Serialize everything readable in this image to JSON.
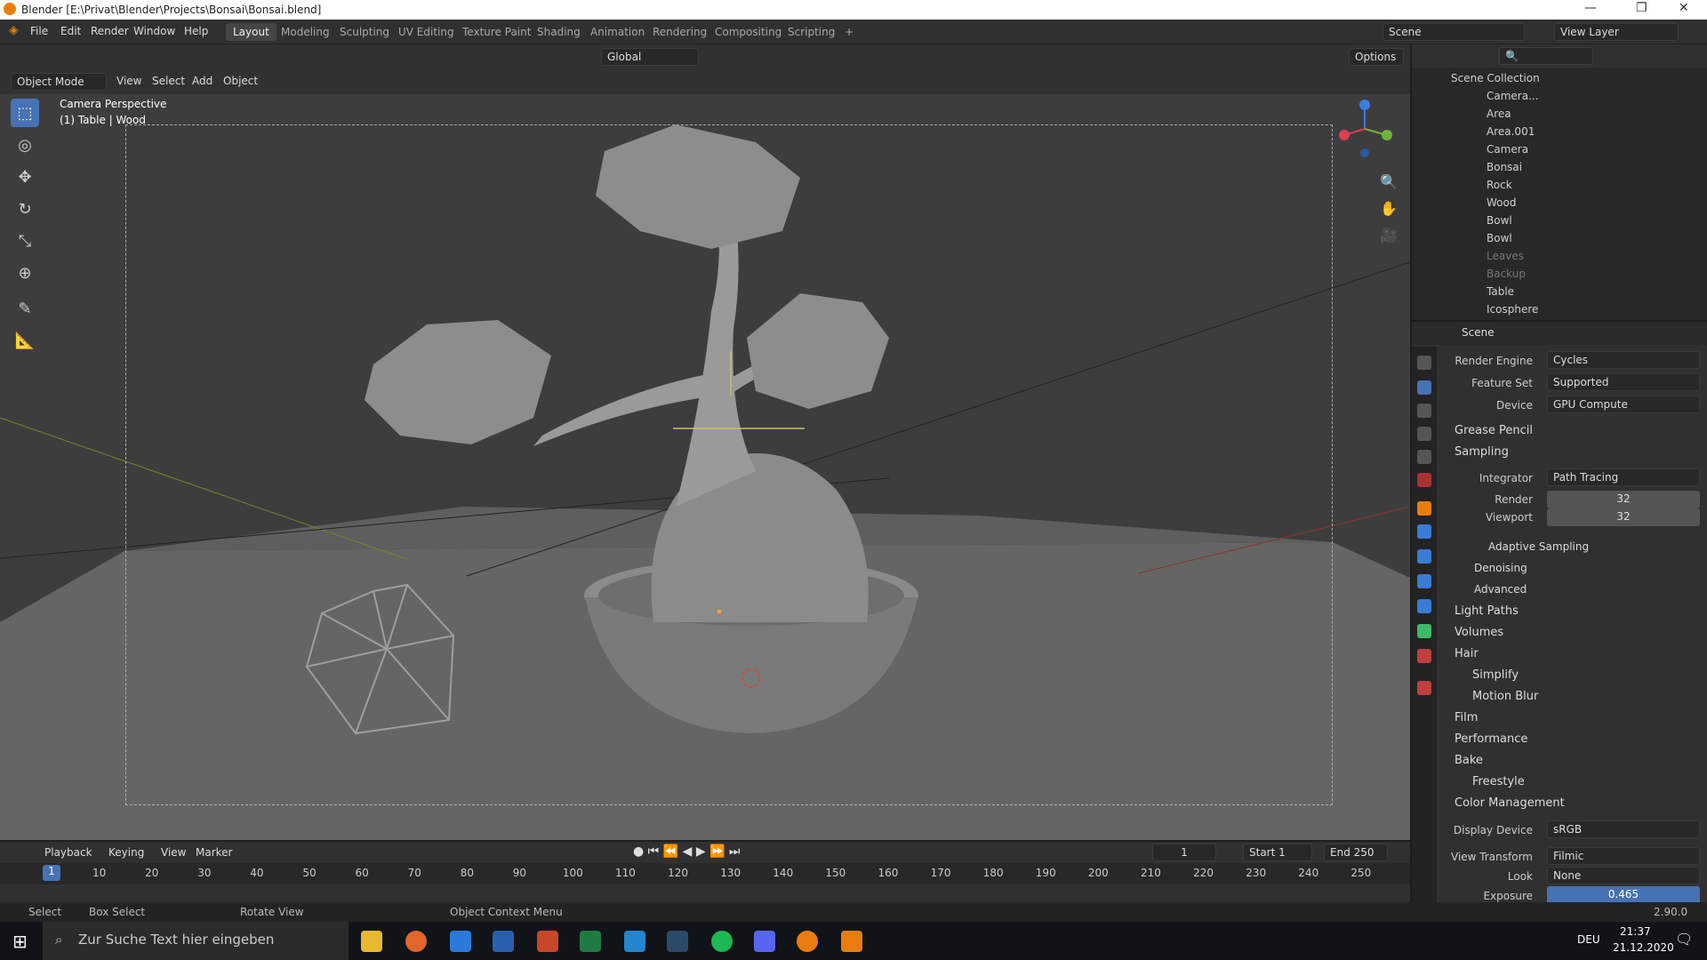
{
  "window": {
    "title": "Blender [E:\\Privat\\Blender\\Projects\\Bonsai\\Bonsai.blend]"
  },
  "menu": [
    "File",
    "Edit",
    "Render",
    "Window",
    "Help"
  ],
  "workspaces": [
    "Layout",
    "Modeling",
    "Sculpting",
    "UV Editing",
    "Texture Paint",
    "Shading",
    "Animation",
    "Rendering",
    "Compositing",
    "Scripting"
  ],
  "scene_name": "Scene",
  "view_layer": "View Layer",
  "viewport": {
    "mode": "Object Mode",
    "menus": [
      "View",
      "Select",
      "Add",
      "Object"
    ],
    "orientation": "Global",
    "options": "Options",
    "camera_label": "Camera Perspective",
    "object_label": "(1) Table | Wood"
  },
  "outliner": {
    "root": "Scene Collection",
    "rows": [
      "Camera...",
      "Area",
      "Area.001",
      "Camera",
      "Bonsai",
      "Rock",
      "Wood",
      "Bowl",
      "Bowl",
      "Leaves",
      "Backup",
      "Table",
      "Icosphere"
    ]
  },
  "properties": {
    "header": "Scene",
    "render_engine_label": "Render Engine",
    "render_engine": "Cycles",
    "feature_set_label": "Feature Set",
    "feature_set": "Supported",
    "device_label": "Device",
    "device": "GPU Compute",
    "grease_pencil": "Grease Pencil",
    "sampling": "Sampling",
    "integrator_label": "Integrator",
    "integrator": "Path Tracing",
    "render_label": "Render",
    "render_samples": "32",
    "viewport_label": "Viewport",
    "viewport_samples": "32",
    "adaptive": "Adaptive Sampling",
    "denoising": "Denoising",
    "advanced": "Advanced",
    "light_paths": "Light Paths",
    "volumes": "Volumes",
    "hair": "Hair",
    "simplify": "Simplify",
    "motion_blur": "Motion Blur",
    "film": "Film",
    "performance": "Performance",
    "bake": "Bake",
    "freestyle": "Freestyle",
    "color_management": "Color Management",
    "display_device_label": "Display Device",
    "display_device": "sRGB",
    "view_transform_label": "View Transform",
    "view_transform": "Filmic",
    "look_label": "Look",
    "look": "None",
    "exposure_label": "Exposure",
    "exposure": "0.465"
  },
  "timeline": {
    "menus": [
      "Playback",
      "Keying",
      "View",
      "Marker"
    ],
    "current": "1",
    "start_label": "Start",
    "start": "1",
    "end_label": "End",
    "end": "250",
    "ticks": [
      "10",
      "20",
      "30",
      "40",
      "50",
      "60",
      "70",
      "80",
      "90",
      "100",
      "110",
      "120",
      "130",
      "140",
      "150",
      "160",
      "170",
      "180",
      "190",
      "200",
      "210",
      "220",
      "230",
      "240",
      "250"
    ]
  },
  "status": {
    "select": "Select",
    "box_select": "Box Select",
    "rotate": "Rotate View",
    "context_menu": "Object Context Menu",
    "version": "2.90.0"
  },
  "taskbar": {
    "search": "Zur Suche Text hier eingeben",
    "lang": "DEU",
    "time": "21:37",
    "date": "21.12.2020"
  }
}
